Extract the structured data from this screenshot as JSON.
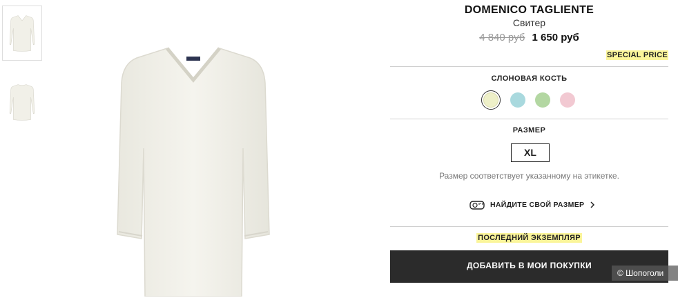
{
  "gallery": {
    "thumbnails": [
      "front view",
      "back view"
    ]
  },
  "product": {
    "brand": "DOMENICO TAGLIENTE",
    "type": "Свитер",
    "old_price": "4 840 руб",
    "new_price": "1 650 руб",
    "badge": "SPECIAL PRICE"
  },
  "color": {
    "label": "СЛОНОВАЯ КОСТЬ",
    "swatches": [
      {
        "name": "ivory",
        "hex": "#eef0c8",
        "selected": true
      },
      {
        "name": "light-blue",
        "hex": "#a9d9de"
      },
      {
        "name": "light-green",
        "hex": "#b3d7a2"
      },
      {
        "name": "light-pink",
        "hex": "#f2c9d2"
      }
    ]
  },
  "size": {
    "label": "РАЗМЕР",
    "selected": "XL",
    "note": "Размер соответствует указанному на этикетке.",
    "finder": "НАЙДИТЕ СВОЙ РАЗМЕР"
  },
  "stock": {
    "notice": "ПОСЛЕДНИЙ ЭКЗЕМПЛЯР"
  },
  "cart": {
    "add_label": "ДОБАВИТЬ В МОИ ПОКУПКИ"
  },
  "watermark": "© Шопоголи",
  "colors": {
    "highlight": "#fbf59a",
    "button": "#2b2b2b",
    "sweater": "#f3f2ea"
  }
}
